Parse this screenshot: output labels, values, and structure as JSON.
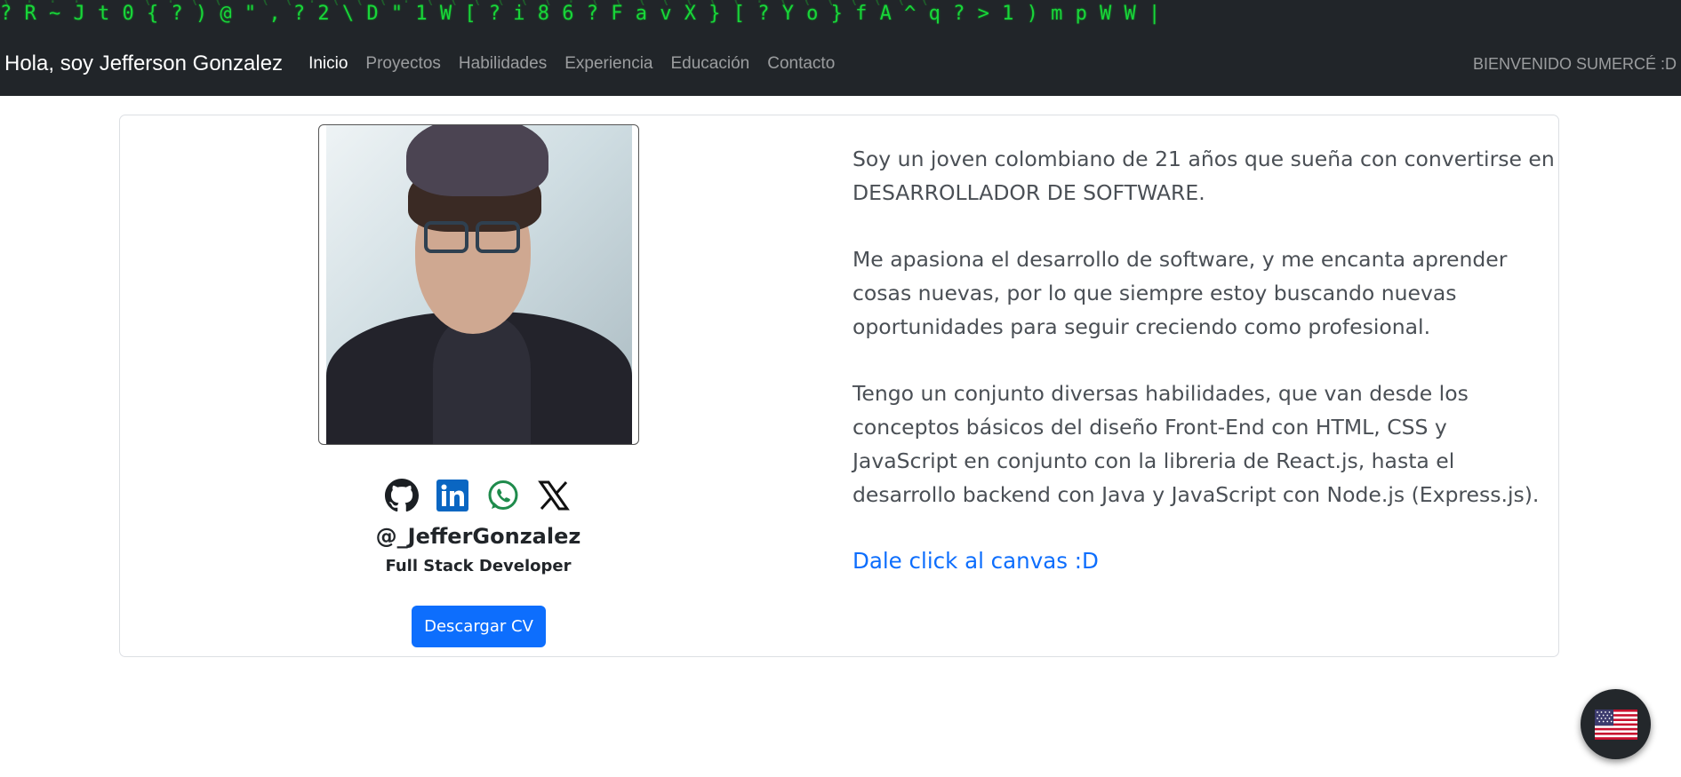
{
  "canvas": {
    "matrix_row": "? R ~ J t 0 { ? ) @ \" , ? 2 \\ D \" 1 W [ ? i 8 6 ? F a v X } [ ? Y o } f A ^ q ? > 1 ) m p W W |",
    "matrix_row_upper": "( ! ? ! \" ' ( ! ( ( ' ( ( ! ( ( ( ! ( ( ( ( ( ( ! ( ( ( ( ( ( ( ! ( ( ( ( ( ( ("
  },
  "navbar": {
    "brand": "Hola, soy Jefferson Gonzalez",
    "links": [
      "Inicio",
      "Proyectos",
      "Habilidades",
      "Experiencia",
      "Educación",
      "Contacto"
    ],
    "active_index": 0,
    "welcome": "BIENVENIDO SUMERCÉ :D"
  },
  "profile": {
    "socials": [
      "github-icon",
      "linkedin-icon",
      "whatsapp-icon",
      "x-icon"
    ],
    "handle": "@_JefferGonzalez",
    "role": "Full Stack Developer",
    "cv_button": "Descargar CV"
  },
  "about": {
    "paragraphs": [
      "Soy un joven colombiano de 21 años que sueña con convertirse en DESARROLLADOR DE SOFTWARE.",
      "Me apasiona el desarrollo de software, y me encanta aprender cosas nuevas, por lo que siempre estoy buscando nuevas oportunidades para seguir creciendo como profesional.",
      "Tengo un conjunto diversas habilidades, que van desde los conceptos básicos del diseño Front-End con HTML, CSS y JavaScript en conjunto con la libreria de React.js, hasta el desarrollo backend con Java y JavaScript con Node.js (Express.js)."
    ],
    "canvas_link": "Dale click al canvas :D"
  },
  "language_toggle": {
    "icon": "us-flag-icon"
  },
  "colors": {
    "navbar_bg": "#212529",
    "matrix_green": "#19d63a",
    "primary": "#0d6efd",
    "linkedin": "#0a66c2",
    "whatsapp": "#25a25a"
  }
}
